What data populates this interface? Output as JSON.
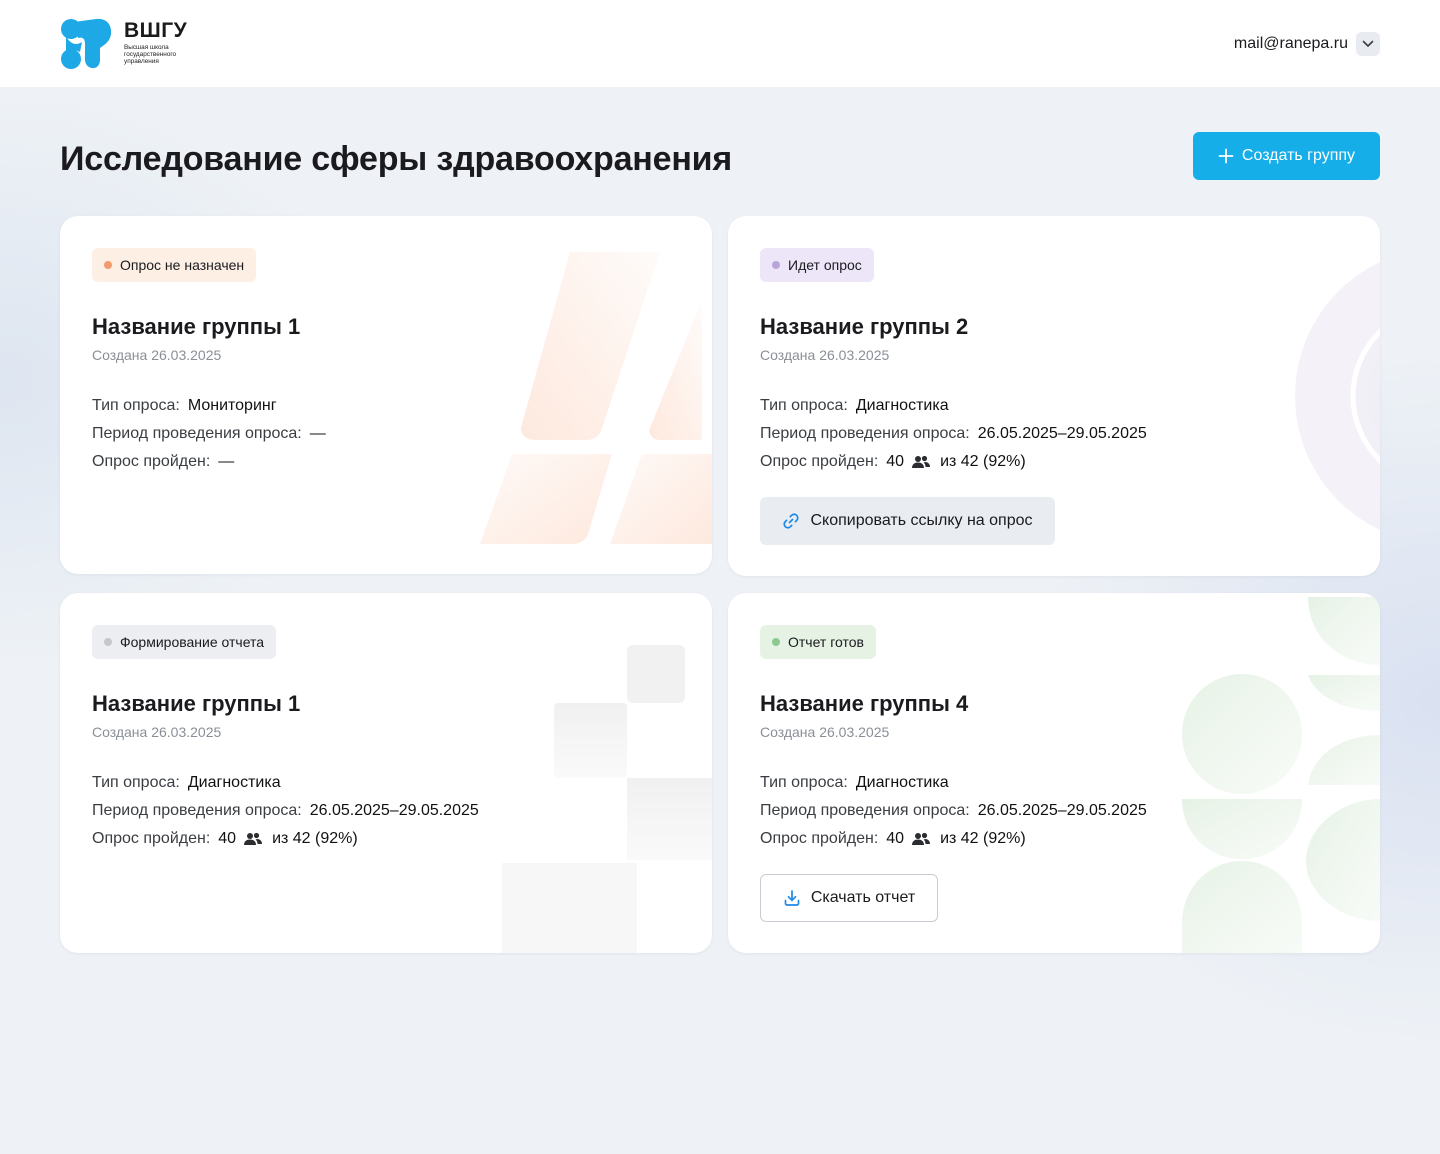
{
  "header": {
    "logo_title": "ВШГУ",
    "logo_subtitle": "Высшая школа государственного управления",
    "user_email": "mail@ranepa.ru"
  },
  "page": {
    "title": "Исследование сферы здравоохранения",
    "create_button_label": "Создать группу"
  },
  "labels": {
    "survey_type": "Тип опроса:",
    "survey_period": "Период проведения опроса:",
    "survey_passed": "Опрос пройден:"
  },
  "cards": [
    {
      "status": "Опрос не назначен",
      "title": "Название группы 1",
      "created": "Создана 26.03.2025",
      "survey_type": "Мониторинг",
      "period": "—",
      "passed": "—"
    },
    {
      "status": "Идет опрос",
      "title": "Название группы 2",
      "created": "Создана 26.03.2025",
      "survey_type": "Диагностика",
      "period": "26.05.2025–29.05.2025",
      "passed_count": "40",
      "passed_total": "из 42 (92%)",
      "action_label": "Скопировать ссылку на опрос"
    },
    {
      "status": "Формирование отчета",
      "title": "Название группы 1",
      "created": "Создана 26.03.2025",
      "survey_type": "Диагностика",
      "period": "26.05.2025–29.05.2025",
      "passed_count": "40",
      "passed_total": "из 42 (92%)"
    },
    {
      "status": "Отчет готов",
      "title": "Название группы 4",
      "created": "Создана 26.03.2025",
      "survey_type": "Диагностика",
      "period": "26.05.2025–29.05.2025",
      "passed_count": "40",
      "passed_total": "из 42 (92%)",
      "action_label": "Скачать отчет"
    }
  ],
  "colors": {
    "accent": "#16aee8",
    "logo": "#1fa8e6",
    "status_not_assigned": "#f29a6e",
    "status_in_progress": "#b8a6d9",
    "status_report_forming": "#c4c7cc",
    "status_report_ready": "#8cc98e"
  }
}
